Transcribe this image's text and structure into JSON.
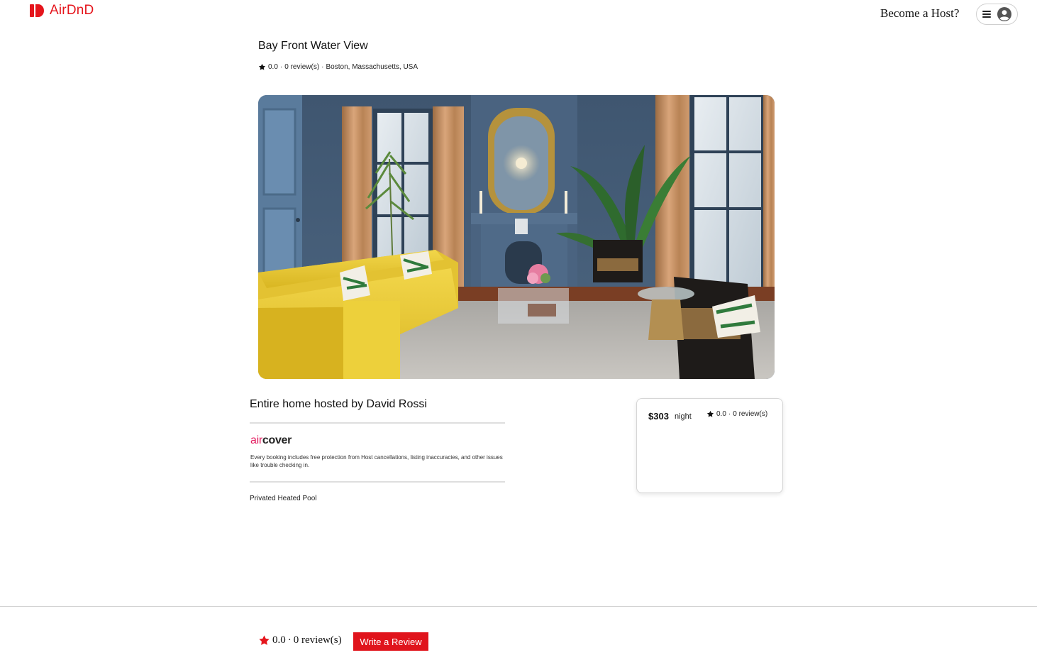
{
  "header": {
    "logo_text": "AirDnD",
    "logo_icon": "airdnd-logo-icon",
    "host_link": "Become a Host?",
    "menu_icon": "hamburger-icon",
    "avatar_icon": "user-avatar-icon"
  },
  "listing": {
    "title": "Bay Front Water View",
    "rating": "0.0",
    "separator": "·",
    "reviews": "0 review(s)",
    "location": "Boston, Massachusetts, USA",
    "host_heading": "Entire home hosted by David Rossi",
    "aircover_air": "air",
    "aircover_cover": "cover",
    "aircover_text": "Every booking includes free protection from Host cancellations, listing inaccuracies, and other issues like trouble checking in.",
    "amenity": "Privated Heated Pool"
  },
  "booking": {
    "price": "$303",
    "unit": "night",
    "rating": "0.0",
    "separator": "·",
    "reviews": "0 review(s)"
  },
  "reviews_section": {
    "rating": "0.0",
    "separator": "·",
    "reviews": "0 review(s)",
    "button_label": "Write a Review"
  },
  "colors": {
    "brand": "#e5151c",
    "aircover_pink": "#e31c5f",
    "button": "#e0141c",
    "star_large": "#e5151c"
  }
}
